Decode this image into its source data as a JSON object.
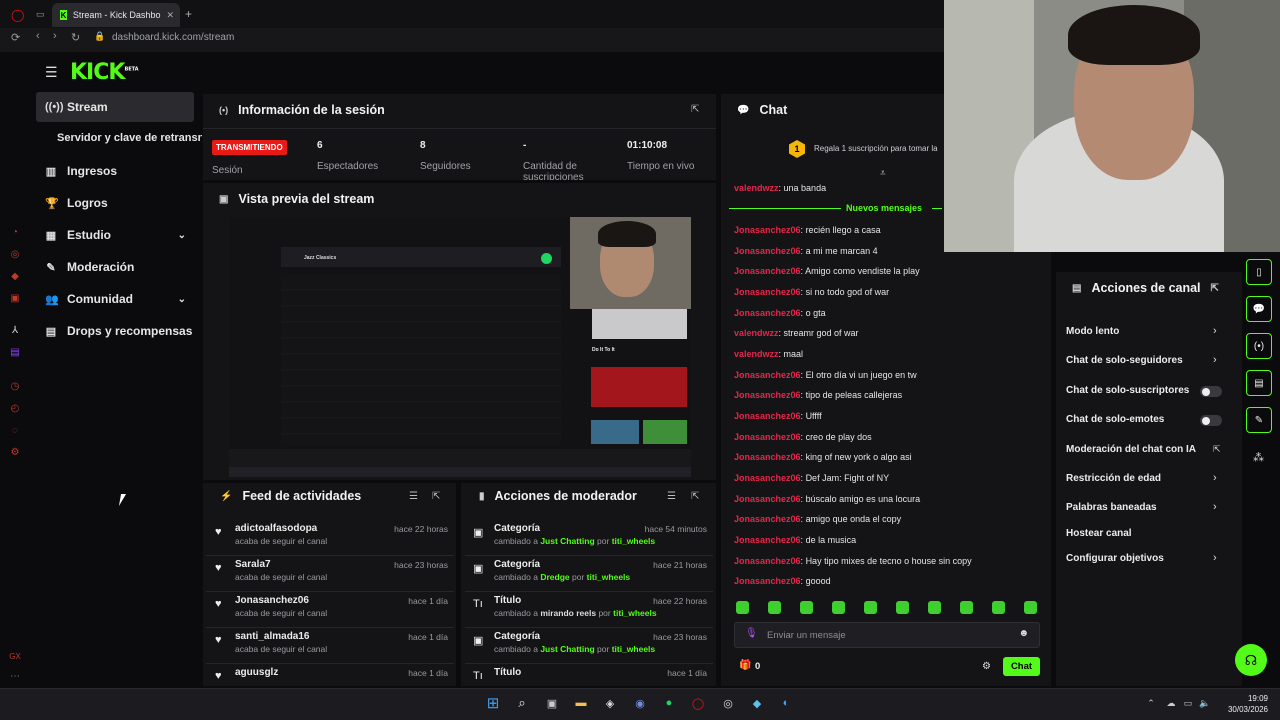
{
  "browser": {
    "tab_title": "Stream - Kick Dashbo",
    "url": "dashboard.kick.com/stream",
    "new_tab": "+"
  },
  "sidebar": {
    "logo": "KICK",
    "logo_sup": "BETA",
    "items": [
      {
        "label": "Stream",
        "icon": "broadcast-icon"
      },
      {
        "label": "Servidor y clave de retransn"
      },
      {
        "label": "Ingresos",
        "icon": "chart-icon"
      },
      {
        "label": "Logros",
        "icon": "trophy-icon"
      },
      {
        "label": "Estudio",
        "icon": "studio-icon"
      },
      {
        "label": "Moderación",
        "icon": "wrench-icon"
      },
      {
        "label": "Comunidad",
        "icon": "people-icon"
      },
      {
        "label": "Drops y recompensas",
        "icon": "gift-icon"
      }
    ]
  },
  "session": {
    "title": "Información de la sesión",
    "live_badge": "TRANSMITIENDO",
    "session_label": "Sesión",
    "stats": [
      {
        "value": "6",
        "label": "Espectadores"
      },
      {
        "value": "8",
        "label": "Seguidores"
      },
      {
        "value": "-",
        "label": "Cantidad de suscripciones"
      },
      {
        "value": "01:10:08",
        "label": "Tiempo en vivo"
      }
    ]
  },
  "preview": {
    "title": "Vista previa del stream",
    "playlist_title": "Jazz Classics",
    "track_now": "Do It To It"
  },
  "feed": {
    "title": "Feed de actividades",
    "rows": [
      {
        "name": "adictoalfasodopa",
        "sub": "acaba de seguir el canal",
        "time": "hace 22 horas"
      },
      {
        "name": "Sarala7",
        "sub": "acaba de seguir el canal",
        "time": "hace 23 horas"
      },
      {
        "name": "Jonasanchez06",
        "sub": "acaba de seguir el canal",
        "time": "hace 1 día"
      },
      {
        "name": "santi_almada16",
        "sub": "acaba de seguir el canal",
        "time": "hace 1 día"
      },
      {
        "name": "aguusglz",
        "sub": "",
        "time": "hace 1 día"
      }
    ]
  },
  "moderator": {
    "title": "Acciones de moderador",
    "rows": [
      {
        "name": "Categoría",
        "pre": "cambiado a",
        "value": "Just Chatting",
        "by": "por",
        "user": "titi_wheels",
        "time": "hace 54 minutos"
      },
      {
        "name": "Categoría",
        "pre": "cambiado a",
        "value": "Dredge",
        "by": "por",
        "user": "titi_wheels",
        "time": "hace 21 horas"
      },
      {
        "name": "Título",
        "pre": "cambiado a",
        "value": "mirando reels",
        "by": "por",
        "user": "titi_wheels",
        "time": "hace 22 horas"
      },
      {
        "name": "Categoría",
        "pre": "cambiado a",
        "value": "Just Chatting",
        "by": "por",
        "user": "titi_wheels",
        "time": "hace 23 horas"
      },
      {
        "name": "Título",
        "pre": "",
        "value": "",
        "by": "",
        "user": "",
        "time": "hace 1 día"
      }
    ]
  },
  "chat": {
    "title": "Chat",
    "gift_banner": "Regala 1 suscripción para tomar la",
    "gift_count": "1",
    "new_messages": "Nuevos mensajes",
    "messages": [
      {
        "user": "valendwzz",
        "text": "una banda",
        "color": "#e5264a"
      },
      {
        "user": "Jonasanchez06",
        "text": "recién llego a casa",
        "color": "#e5264a"
      },
      {
        "user": "Jonasanchez06",
        "text": "a mi me marcan 4",
        "color": "#e5264a"
      },
      {
        "user": "Jonasanchez06",
        "text": "Amigo como vendiste la play",
        "color": "#e5264a"
      },
      {
        "user": "Jonasanchez06",
        "text": "si no todo god of war",
        "color": "#e5264a"
      },
      {
        "user": "Jonasanchez06",
        "text": "o gta",
        "color": "#e5264a"
      },
      {
        "user": "valendwzz",
        "text": "streamr god of war",
        "color": "#e5264a"
      },
      {
        "user": "valendwzz",
        "text": "maal",
        "color": "#e5264a"
      },
      {
        "user": "Jonasanchez06",
        "text": "El otro día vi un juego en tw",
        "color": "#e5264a"
      },
      {
        "user": "Jonasanchez06",
        "text": "tipo de peleas callejeras",
        "color": "#e5264a"
      },
      {
        "user": "Jonasanchez06",
        "text": "Uffff",
        "color": "#e5264a"
      },
      {
        "user": "Jonasanchez06",
        "text": "creo de play dos",
        "color": "#e5264a"
      },
      {
        "user": "Jonasanchez06",
        "text": "king of new york o algo asi",
        "color": "#e5264a"
      },
      {
        "user": "Jonasanchez06",
        "text": "Def Jam: Fight of NY",
        "color": "#e5264a"
      },
      {
        "user": "Jonasanchez06",
        "text": "búscalo amigo es una locura",
        "color": "#e5264a"
      },
      {
        "user": "Jonasanchez06",
        "text": "amigo que onda el copy",
        "color": "#e5264a"
      },
      {
        "user": "Jonasanchez06",
        "text": "de la musica",
        "color": "#e5264a"
      },
      {
        "user": "Jonasanchez06",
        "text": "Hay tipo mixes de tecno o house sin copy",
        "color": "#e5264a"
      },
      {
        "user": "Jonasanchez06",
        "text": "goood",
        "color": "#e5264a"
      }
    ],
    "input_placeholder": "Enviar un mensaje",
    "points": "0",
    "send_label": "Chat"
  },
  "channel_actions": {
    "title": "Acciones de canal",
    "items": [
      {
        "label": "Modo lento",
        "control": "chevron"
      },
      {
        "label": "Chat de solo-seguidores",
        "control": "chevron"
      },
      {
        "label": "Chat de solo-suscriptores",
        "control": "toggle"
      },
      {
        "label": "Chat de solo-emotes",
        "control": "toggle"
      },
      {
        "label": "Moderación del chat con IA",
        "control": "external"
      },
      {
        "label": "Restricción de edad",
        "control": "chevron"
      },
      {
        "label": "Palabras baneadas",
        "control": "chevron"
      },
      {
        "label": "Hostear canal",
        "control": "none"
      },
      {
        "label": "Configurar objetivos",
        "control": "chevron"
      }
    ]
  },
  "taskbar": {
    "time": "19:09",
    "date": "30/03/2026"
  },
  "colors": {
    "accent": "#53fc18",
    "live": "#e91916",
    "chat_user": "#e5264a"
  }
}
